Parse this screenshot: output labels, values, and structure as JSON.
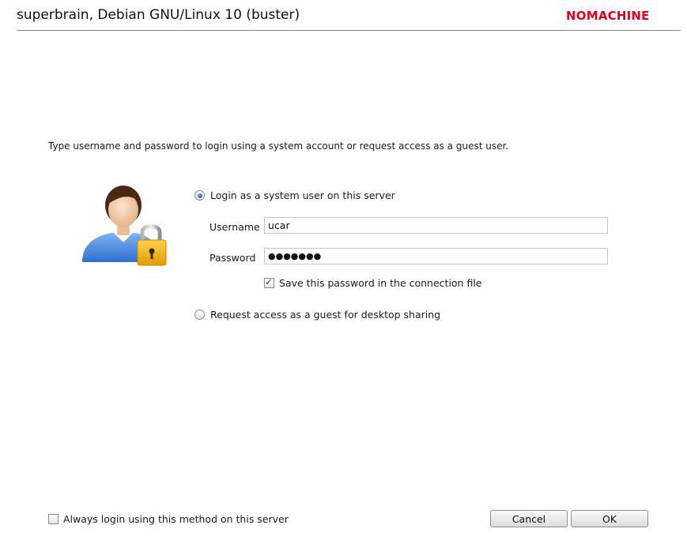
{
  "window": {
    "title": "superbrain, Debian GNU/Linux 10 (buster)",
    "brand": "NOMACHINE",
    "brand_color": "#e3001b"
  },
  "instructions": "Type username and password to login using a system account or request access as a guest user.",
  "avatar_icon": "user-with-lock-icon",
  "login_options": {
    "system_user": {
      "label": "Login as a system user on this server",
      "selected": true
    },
    "guest": {
      "label": "Request access as a guest for desktop sharing",
      "selected": false
    }
  },
  "fields": {
    "username_label": "Username",
    "username_value": "ucar",
    "password_label": "Password",
    "password_value": "●●●●●●●"
  },
  "save_password": {
    "label": "Save this password in the connection file",
    "checked": true
  },
  "always_login": {
    "label": "Always login using this method on this server",
    "checked": false
  },
  "buttons": {
    "cancel": "Cancel",
    "ok": "OK"
  }
}
